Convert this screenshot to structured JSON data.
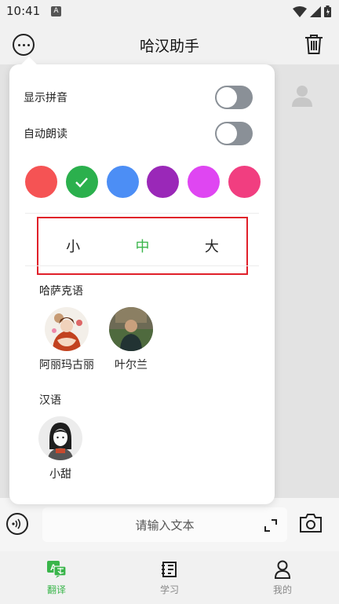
{
  "status_bar": {
    "time": "10:41",
    "notification_icon": "A"
  },
  "app_bar": {
    "title": "哈汉助手"
  },
  "popup": {
    "show_pinyin": {
      "label": "显示拼音",
      "enabled": false
    },
    "auto_read": {
      "label": "自动朗读",
      "enabled": false
    },
    "colors": [
      {
        "color": "#f55354",
        "selected": false
      },
      {
        "color": "#2bb04d",
        "selected": true
      },
      {
        "color": "#4c8ef5",
        "selected": false
      },
      {
        "color": "#9a28b8",
        "selected": false
      },
      {
        "color": "#df46f2",
        "selected": false
      },
      {
        "color": "#f13e80",
        "selected": false
      }
    ],
    "font_sizes": [
      {
        "label": "小",
        "selected": false
      },
      {
        "label": "中",
        "selected": true
      },
      {
        "label": "大",
        "selected": false
      }
    ],
    "kazakh": {
      "label": "哈萨克语",
      "voices": [
        {
          "name": "阿丽玛古丽"
        },
        {
          "name": "叶尔兰"
        }
      ]
    },
    "chinese": {
      "label": "汉语",
      "voices": [
        {
          "name": "小甜"
        }
      ]
    }
  },
  "input_bar": {
    "placeholder": "请输入文本"
  },
  "tab_bar": {
    "tabs": [
      {
        "label": "翻译",
        "icon": "translate-icon",
        "active": true
      },
      {
        "label": "学习",
        "icon": "study-icon",
        "active": false
      },
      {
        "label": "我的",
        "icon": "person-icon",
        "active": false
      }
    ]
  },
  "theme": {
    "accent": "#39b54a",
    "highlight_border": "#e0202a"
  }
}
